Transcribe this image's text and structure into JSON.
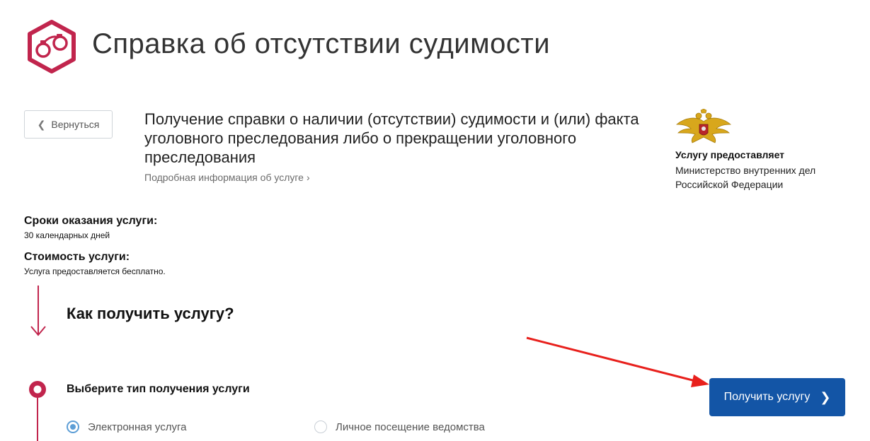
{
  "header": {
    "title": "Справка об отсутствии судимости",
    "logo_icon": "handcuffs-icon"
  },
  "back_button": {
    "label": "Вернуться",
    "icon": "chevron-left-icon"
  },
  "service": {
    "title": "Получение справки о наличии (отсутствии) судимости и (или) факта уголовного преследования либо о прекращении уголовного преследования",
    "more_link": "Подробная информация об услуге",
    "more_icon": "chevron-right-icon"
  },
  "provider": {
    "label": "Услугу предоставляет",
    "name": "Министерство внутренних дел Российской Федерации",
    "emblem_icon": "coat-of-arms-icon"
  },
  "info": {
    "terms_title": "Сроки оказания услуги:",
    "terms_value": "30 календарных дней",
    "cost_title": "Стоимость услуги:",
    "cost_value": "Услуга предоставляется бесплатно."
  },
  "how": {
    "title": "Как получить услугу?",
    "step_title": "Выберите тип получения услуги",
    "options": [
      {
        "label": "Электронная услуга",
        "selected": true
      },
      {
        "label": "Личное посещение ведомства",
        "selected": false
      }
    ]
  },
  "cta": {
    "label": "Получить услугу",
    "icon": "chevron-right-icon"
  },
  "colors": {
    "brand": "#c1254d",
    "primary_button": "#1355a6",
    "annotation_arrow": "#e8201c",
    "radio_selected": "#5d9ed6"
  }
}
